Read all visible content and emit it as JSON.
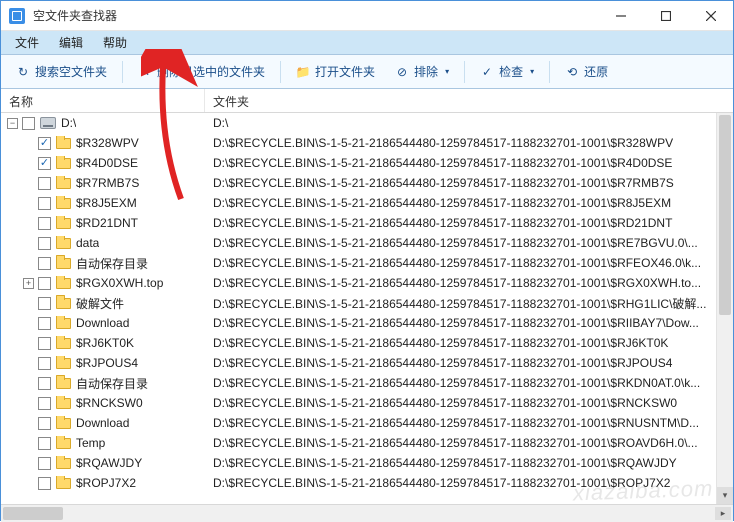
{
  "window": {
    "title": "空文件夹查找器"
  },
  "menu": {
    "file": "文件",
    "edit": "编辑",
    "help": "帮助"
  },
  "toolbar": {
    "search": "搜索空文件夹",
    "delete": "删除已选中的文件夹",
    "open": "打开文件夹",
    "exclude": "排除",
    "check": "检查",
    "restore": "还原"
  },
  "columns": {
    "name": "名称",
    "folder": "文件夹"
  },
  "root": {
    "label": "D:\\",
    "path": "D:\\"
  },
  "items": [
    {
      "checked": true,
      "expand": null,
      "name": "$R328WPV",
      "path": "D:\\$RECYCLE.BIN\\S-1-5-21-2186544480-1259784517-1188232701-1001\\$R328WPV"
    },
    {
      "checked": true,
      "expand": null,
      "name": "$R4D0DSE",
      "path": "D:\\$RECYCLE.BIN\\S-1-5-21-2186544480-1259784517-1188232701-1001\\$R4D0DSE"
    },
    {
      "checked": false,
      "expand": null,
      "name": "$R7RMB7S",
      "path": "D:\\$RECYCLE.BIN\\S-1-5-21-2186544480-1259784517-1188232701-1001\\$R7RMB7S"
    },
    {
      "checked": false,
      "expand": null,
      "name": "$R8J5EXM",
      "path": "D:\\$RECYCLE.BIN\\S-1-5-21-2186544480-1259784517-1188232701-1001\\$R8J5EXM"
    },
    {
      "checked": false,
      "expand": null,
      "name": "$RD21DNT",
      "path": "D:\\$RECYCLE.BIN\\S-1-5-21-2186544480-1259784517-1188232701-1001\\$RD21DNT"
    },
    {
      "checked": false,
      "expand": null,
      "name": "data",
      "path": "D:\\$RECYCLE.BIN\\S-1-5-21-2186544480-1259784517-1188232701-1001\\$RE7BGVU.0\\..."
    },
    {
      "checked": false,
      "expand": null,
      "name": "自动保存目录",
      "path": "D:\\$RECYCLE.BIN\\S-1-5-21-2186544480-1259784517-1188232701-1001\\$RFEOX46.0\\k..."
    },
    {
      "checked": false,
      "expand": "+",
      "name": "$RGX0XWH.top",
      "path": "D:\\$RECYCLE.BIN\\S-1-5-21-2186544480-1259784517-1188232701-1001\\$RGX0XWH.to..."
    },
    {
      "checked": false,
      "expand": null,
      "name": "破解文件",
      "path": "D:\\$RECYCLE.BIN\\S-1-5-21-2186544480-1259784517-1188232701-1001\\$RHG1LIC\\破解..."
    },
    {
      "checked": false,
      "expand": null,
      "name": "Download",
      "path": "D:\\$RECYCLE.BIN\\S-1-5-21-2186544480-1259784517-1188232701-1001\\$RIIBAY7\\Dow..."
    },
    {
      "checked": false,
      "expand": null,
      "name": "$RJ6KT0K",
      "path": "D:\\$RECYCLE.BIN\\S-1-5-21-2186544480-1259784517-1188232701-1001\\$RJ6KT0K"
    },
    {
      "checked": false,
      "expand": null,
      "name": "$RJPOUS4",
      "path": "D:\\$RECYCLE.BIN\\S-1-5-21-2186544480-1259784517-1188232701-1001\\$RJPOUS4"
    },
    {
      "checked": false,
      "expand": null,
      "name": "自动保存目录",
      "path": "D:\\$RECYCLE.BIN\\S-1-5-21-2186544480-1259784517-1188232701-1001\\$RKDN0AT.0\\k..."
    },
    {
      "checked": false,
      "expand": null,
      "name": "$RNCKSW0",
      "path": "D:\\$RECYCLE.BIN\\S-1-5-21-2186544480-1259784517-1188232701-1001\\$RNCKSW0"
    },
    {
      "checked": false,
      "expand": null,
      "name": "Download",
      "path": "D:\\$RECYCLE.BIN\\S-1-5-21-2186544480-1259784517-1188232701-1001\\$RNUSNTM\\D..."
    },
    {
      "checked": false,
      "expand": null,
      "name": "Temp",
      "path": "D:\\$RECYCLE.BIN\\S-1-5-21-2186544480-1259784517-1188232701-1001\\$ROAVD6H.0\\..."
    },
    {
      "checked": false,
      "expand": null,
      "name": "$RQAWJDY",
      "path": "D:\\$RECYCLE.BIN\\S-1-5-21-2186544480-1259784517-1188232701-1001\\$RQAWJDY"
    },
    {
      "checked": false,
      "expand": null,
      "name": "$ROPJ7X2",
      "path": "D:\\$RECYCLE.BIN\\S-1-5-21-2186544480-1259784517-1188232701-1001\\$ROPJ7X2"
    }
  ],
  "watermark": "xiazaiba.com"
}
